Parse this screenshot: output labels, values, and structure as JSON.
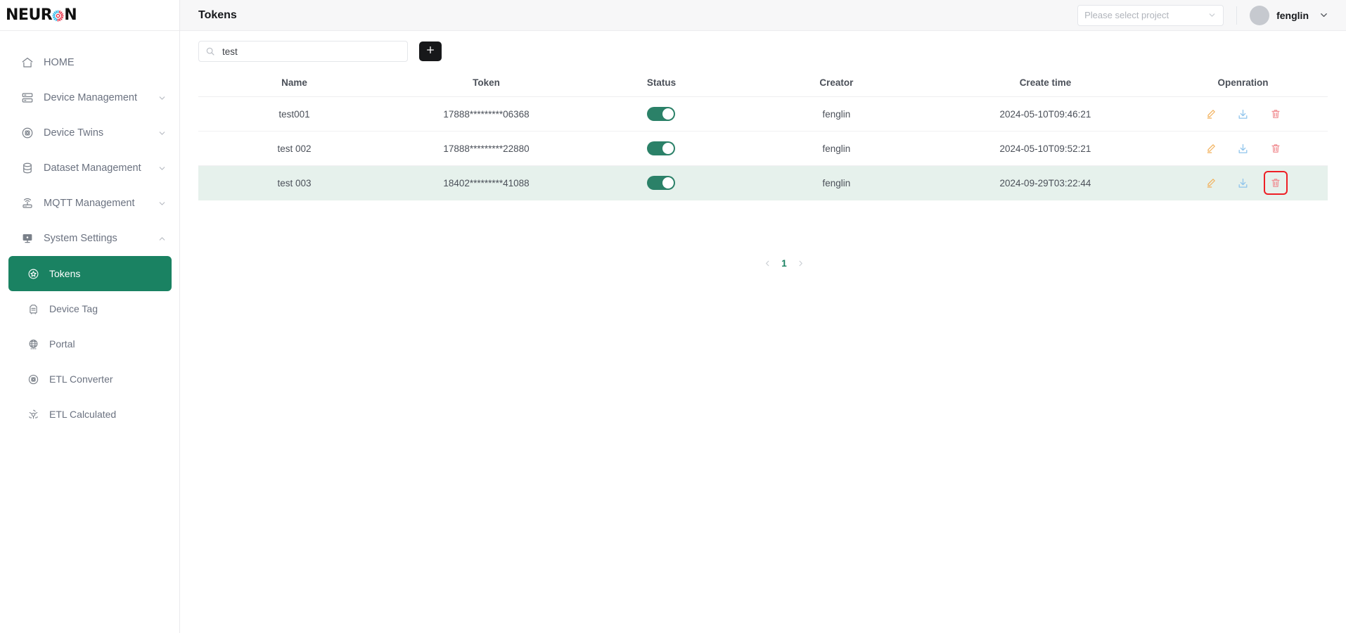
{
  "brand": {
    "name_prefix": "NEUR",
    "name_suffix": "N",
    "burst_colors": [
      "#29b6e8",
      "#e8344a"
    ]
  },
  "sidebar": {
    "items": [
      {
        "label": "HOME",
        "icon": "home-icon",
        "expandable": false,
        "active": false,
        "sub": false
      },
      {
        "label": "Device Management",
        "icon": "server-icon",
        "expandable": true,
        "active": false,
        "sub": false,
        "chevron": "down"
      },
      {
        "label": "Device Twins",
        "icon": "twins-icon",
        "expandable": true,
        "active": false,
        "sub": false,
        "chevron": "down"
      },
      {
        "label": "Dataset Management",
        "icon": "database-icon",
        "expandable": true,
        "active": false,
        "sub": false,
        "chevron": "down"
      },
      {
        "label": "MQTT Management",
        "icon": "router-icon",
        "expandable": true,
        "active": false,
        "sub": false,
        "chevron": "down"
      },
      {
        "label": "System Settings",
        "icon": "monitor-icon",
        "expandable": true,
        "active": false,
        "sub": false,
        "chevron": "up"
      },
      {
        "label": "Tokens",
        "icon": "token-star-icon",
        "expandable": false,
        "active": true,
        "sub": true
      },
      {
        "label": "Device Tag",
        "icon": "tag-icon",
        "expandable": false,
        "active": false,
        "sub": true
      },
      {
        "label": "Portal",
        "icon": "globe-icon",
        "expandable": false,
        "active": false,
        "sub": true
      },
      {
        "label": "ETL Converter",
        "icon": "converter-icon",
        "expandable": false,
        "active": false,
        "sub": true
      },
      {
        "label": "ETL Calculated",
        "icon": "calculated-icon",
        "expandable": false,
        "active": false,
        "sub": true
      }
    ]
  },
  "header": {
    "title": "Tokens",
    "project_select_placeholder": "Please select project",
    "project_select_value": "",
    "user_name": "fenglin"
  },
  "toolbar": {
    "search_value": "test",
    "search_placeholder": "",
    "add_label": "+"
  },
  "table": {
    "columns": [
      "Name",
      "Token",
      "Status",
      "Creator",
      "Create time",
      "Openration"
    ],
    "rows": [
      {
        "name": "test001",
        "token": "17888*********06368",
        "status_on": true,
        "creator": "fenglin",
        "create_time": "2024-05-10T09:46:21",
        "highlighted": false,
        "delete_focused": false
      },
      {
        "name": "test 002",
        "token": "17888*********22880",
        "status_on": true,
        "creator": "fenglin",
        "create_time": "2024-05-10T09:52:21",
        "highlighted": false,
        "delete_focused": false
      },
      {
        "name": "test 003",
        "token": "18402*********41088",
        "status_on": true,
        "creator": "fenglin",
        "create_time": "2024-09-29T03:22:44",
        "highlighted": true,
        "delete_focused": true
      }
    ],
    "operations": [
      "edit-icon",
      "download-icon",
      "delete-icon"
    ]
  },
  "pagination": {
    "prev": "‹",
    "current_page": "1",
    "next": "›"
  },
  "colors": {
    "accent_green": "#1a8262",
    "toggle_on": "#2b8168",
    "row_highlight": "#e6f1ec",
    "focus_outline": "#ee1f25",
    "edit": "#f2b05a",
    "download": "#8fc4ec",
    "delete": "#f08c90"
  }
}
